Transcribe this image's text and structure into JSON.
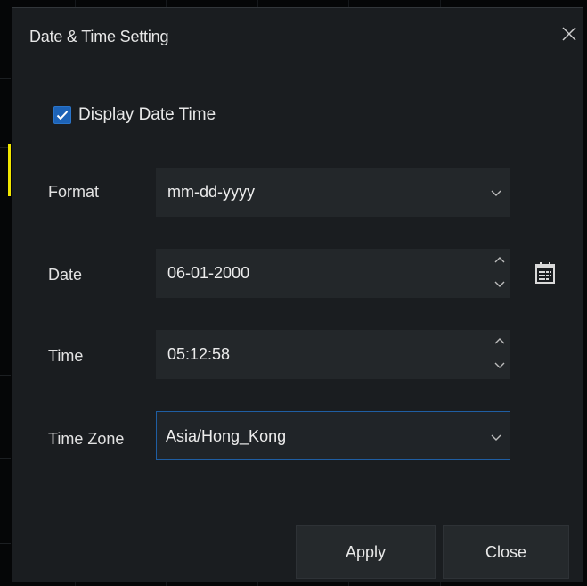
{
  "dialog": {
    "title": "Date & Time Setting"
  },
  "display_datetime": {
    "label": "Display Date Time",
    "checked": true
  },
  "fields": {
    "format": {
      "label": "Format",
      "value": "mm-dd-yyyy"
    },
    "date": {
      "label": "Date",
      "value": "06-01-2000"
    },
    "time": {
      "label": "Time",
      "value": "05:12:58"
    },
    "timezone": {
      "label": "Time Zone",
      "value": "Asia/Hong_Kong"
    }
  },
  "buttons": {
    "apply": "Apply",
    "close": "Close"
  },
  "icons": {
    "close": "close-icon",
    "check": "checkmark-icon",
    "dropdown": "chevron-down-icon",
    "spin_up": "chevron-up-icon",
    "calendar": "calendar-icon"
  },
  "colors": {
    "accent": "#1d63b7",
    "focus_border": "#1f5ea3",
    "dialog_bg": "#1a1d20",
    "field_bg": "#23272a"
  }
}
